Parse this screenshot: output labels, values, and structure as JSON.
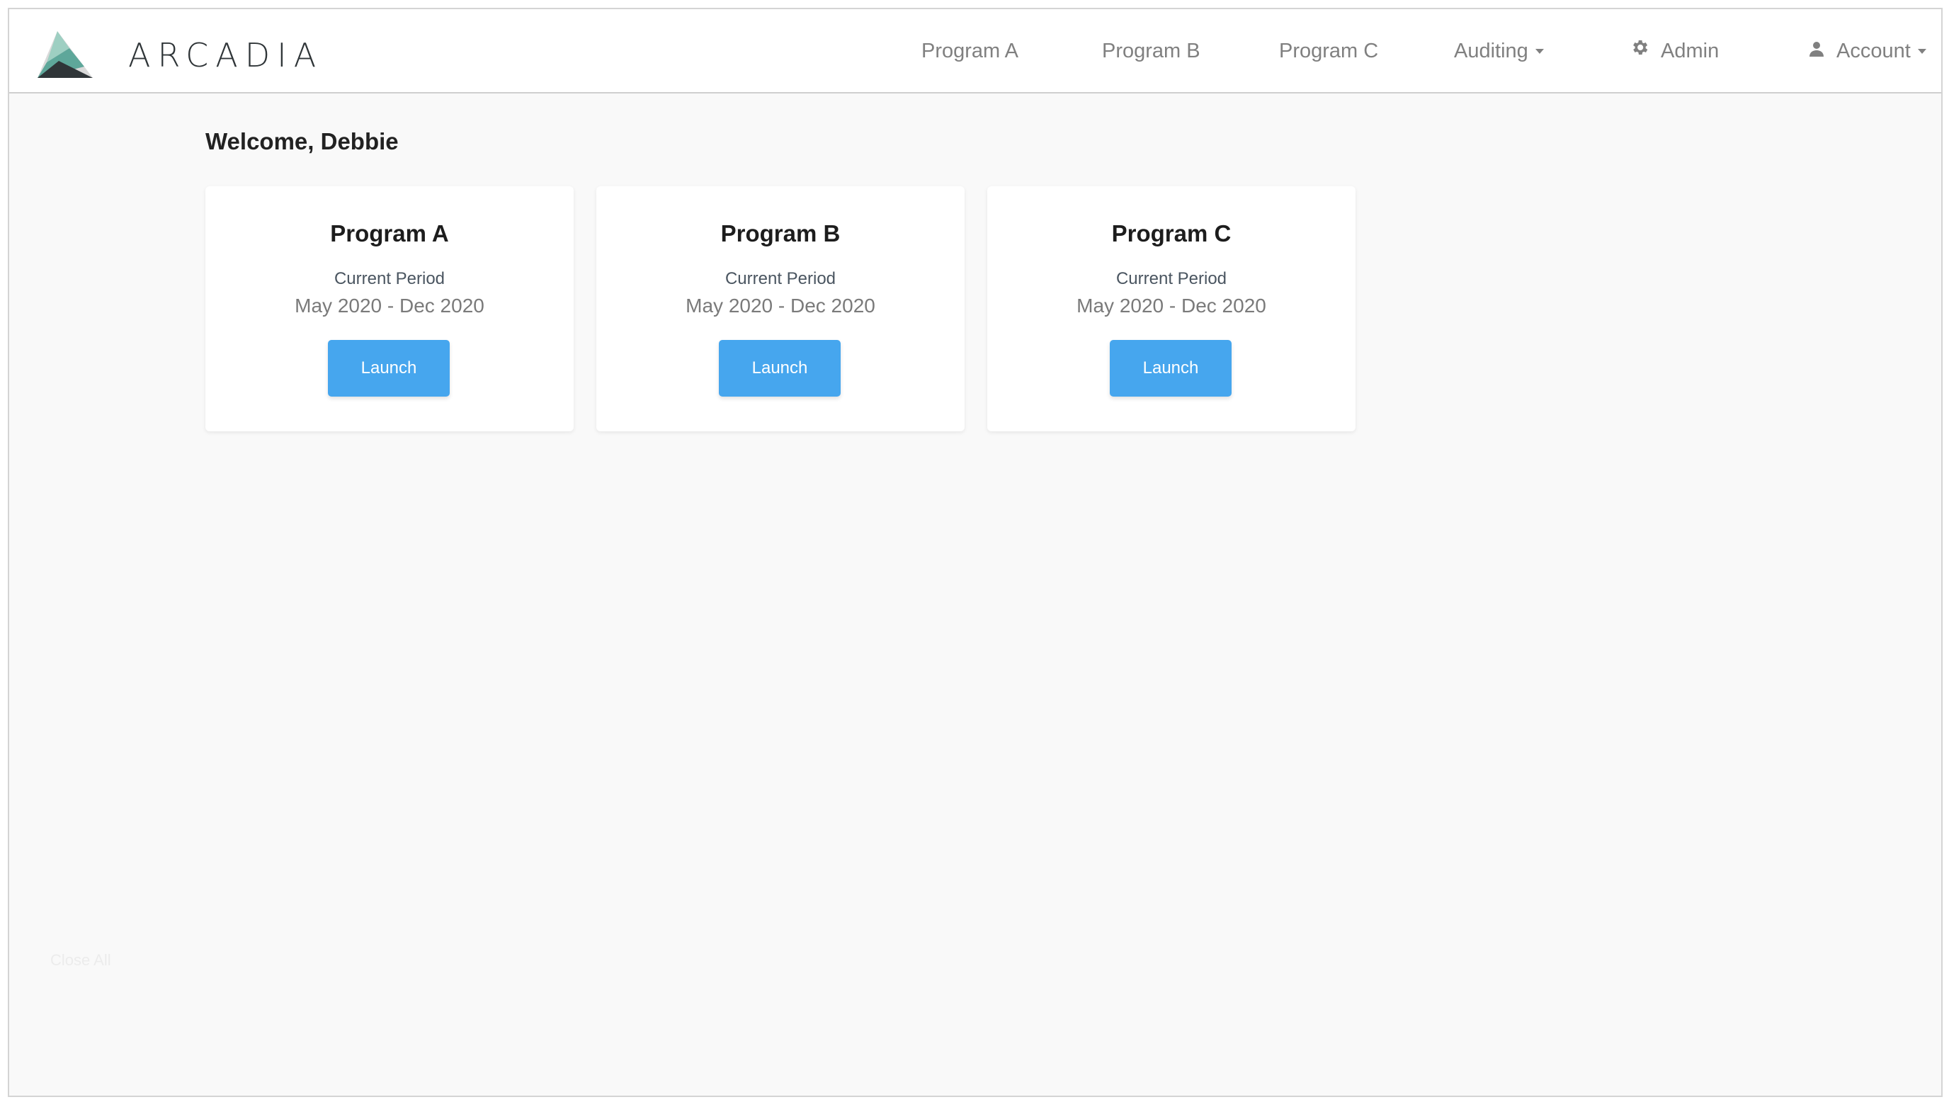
{
  "brand": {
    "name": "ARCADIA"
  },
  "nav": {
    "items": [
      {
        "label": "Program A"
      },
      {
        "label": "Program B"
      },
      {
        "label": "Program C"
      },
      {
        "label": "Auditing"
      },
      {
        "label": "Admin",
        "icon": "gear-icon"
      },
      {
        "label": "Account",
        "icon": "user-icon"
      }
    ]
  },
  "main": {
    "welcome": "Welcome, Debbie",
    "cards": [
      {
        "title": "Program A",
        "subtitle": "Current Period",
        "period": "May 2020 - Dec 2020",
        "button": "Launch"
      },
      {
        "title": "Program B",
        "subtitle": "Current Period",
        "period": "May 2020 - Dec 2020",
        "button": "Launch"
      },
      {
        "title": "Program C",
        "subtitle": "Current Period",
        "period": "May 2020 - Dec 2020",
        "button": "Launch"
      }
    ],
    "faint_text": "Close All"
  },
  "colors": {
    "accent": "#46a6ee",
    "background": "#f9f9f9",
    "nav_text": "#808080"
  }
}
